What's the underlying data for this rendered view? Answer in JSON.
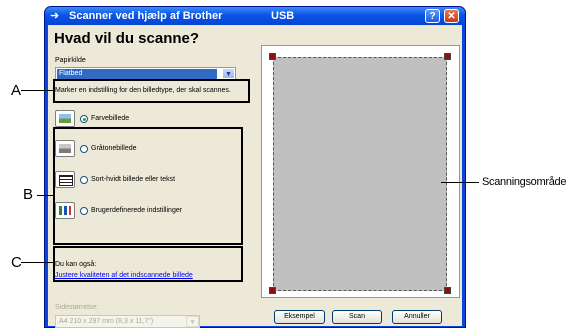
{
  "window": {
    "title": "Scanner ved hjælp af Brother",
    "title_extra": "USB",
    "help_glyph": "?",
    "close_glyph": "✕"
  },
  "heading": "Hvad vil du scanne?",
  "paper_source": {
    "label": "Papirkilde",
    "value": "Flatbed"
  },
  "instruction": "Marker en indstilling for den billedtype, der skal scannes.",
  "image_types": [
    {
      "label": "Farvebillede",
      "selected": true,
      "icon": "color-photo-icon"
    },
    {
      "label": "Gråtonebillede",
      "selected": false,
      "icon": "grayscale-photo-icon"
    },
    {
      "label": "Sort-hvidt billede eller tekst",
      "selected": false,
      "icon": "bw-text-icon"
    },
    {
      "label": "Brugerdefinerede indstillinger",
      "selected": false,
      "icon": "custom-settings-icon"
    }
  ],
  "also": {
    "label": "Du kan også:",
    "link": "Justere kvaliteten af det indscannede billede"
  },
  "page_size": {
    "label": "Sidestørrelse:",
    "value": "A4 210 x 297 mm (8,3 x 11,7\")"
  },
  "buttons": {
    "preview": "Eksempel",
    "scan": "Scan",
    "cancel": "Annuller"
  },
  "callouts": {
    "a": "A",
    "b": "B",
    "c": "C",
    "scan_area": "Scanningsområde"
  },
  "colors": {
    "title_bar": "#0a55e6",
    "dialog_bg": "#ece9d8",
    "selection": "#316ac5",
    "scan_area": "#c0c0c0",
    "handle": "#8b1010"
  }
}
